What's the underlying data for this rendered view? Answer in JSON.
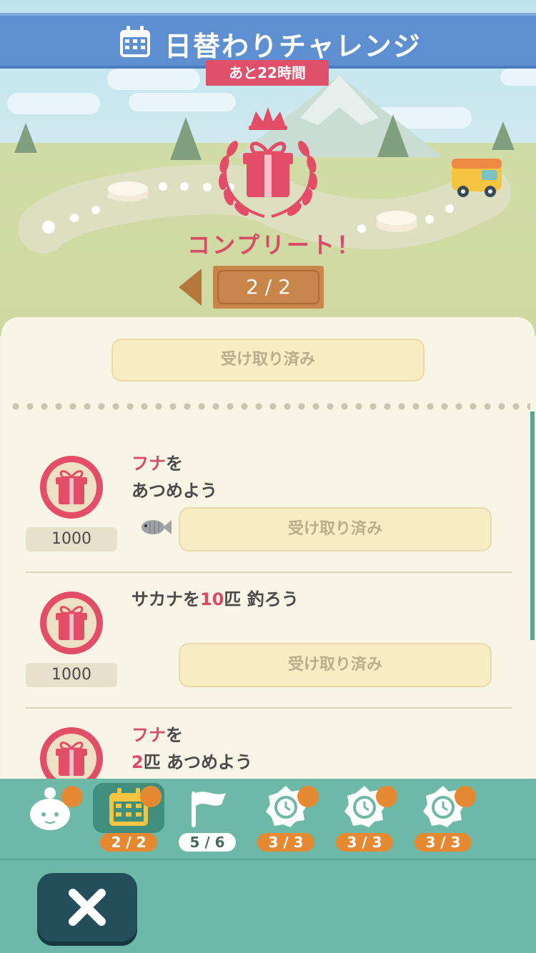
{
  "header": {
    "title": "日替わりチャレンジ",
    "time_left": "あと22時間",
    "title_icon": "calendar-icon"
  },
  "status": {
    "complete_text": "コンプリート！",
    "page_indicator": "2 / 2"
  },
  "card": {
    "main_claim_label": "受け取り済み",
    "tasks": [
      {
        "title_hl": "フナ",
        "title_rest": "を",
        "line2": "あつめよう",
        "reward": "1000",
        "button": "受け取り済み",
        "icon": "fish-icon"
      },
      {
        "line1_a": "サカナを",
        "line1_hl": "10",
        "line1_b": "匹 釣ろう",
        "reward": "1000",
        "button": "受け取り済み"
      },
      {
        "title_hl": "フナ",
        "title_rest": "を",
        "line2_hl": "2",
        "line2_rest": "匹 あつめよう"
      }
    ]
  },
  "nav": {
    "items": [
      {
        "icon": "character-icon",
        "badge": ""
      },
      {
        "icon": "calendar-icon",
        "badge": "2 / 2"
      },
      {
        "icon": "flag-icon",
        "badge": "5 / 6"
      },
      {
        "icon": "timer-icon",
        "badge": "3 / 3"
      },
      {
        "icon": "timer-icon",
        "badge": "3 / 3"
      },
      {
        "icon": "timer-icon",
        "badge": "3 / 3"
      }
    ]
  },
  "colors": {
    "title_bar": "#5d8fd1",
    "accent_red": "#d94a65",
    "nav_bg": "#6db8a6",
    "badge_orange": "#e58a33"
  }
}
